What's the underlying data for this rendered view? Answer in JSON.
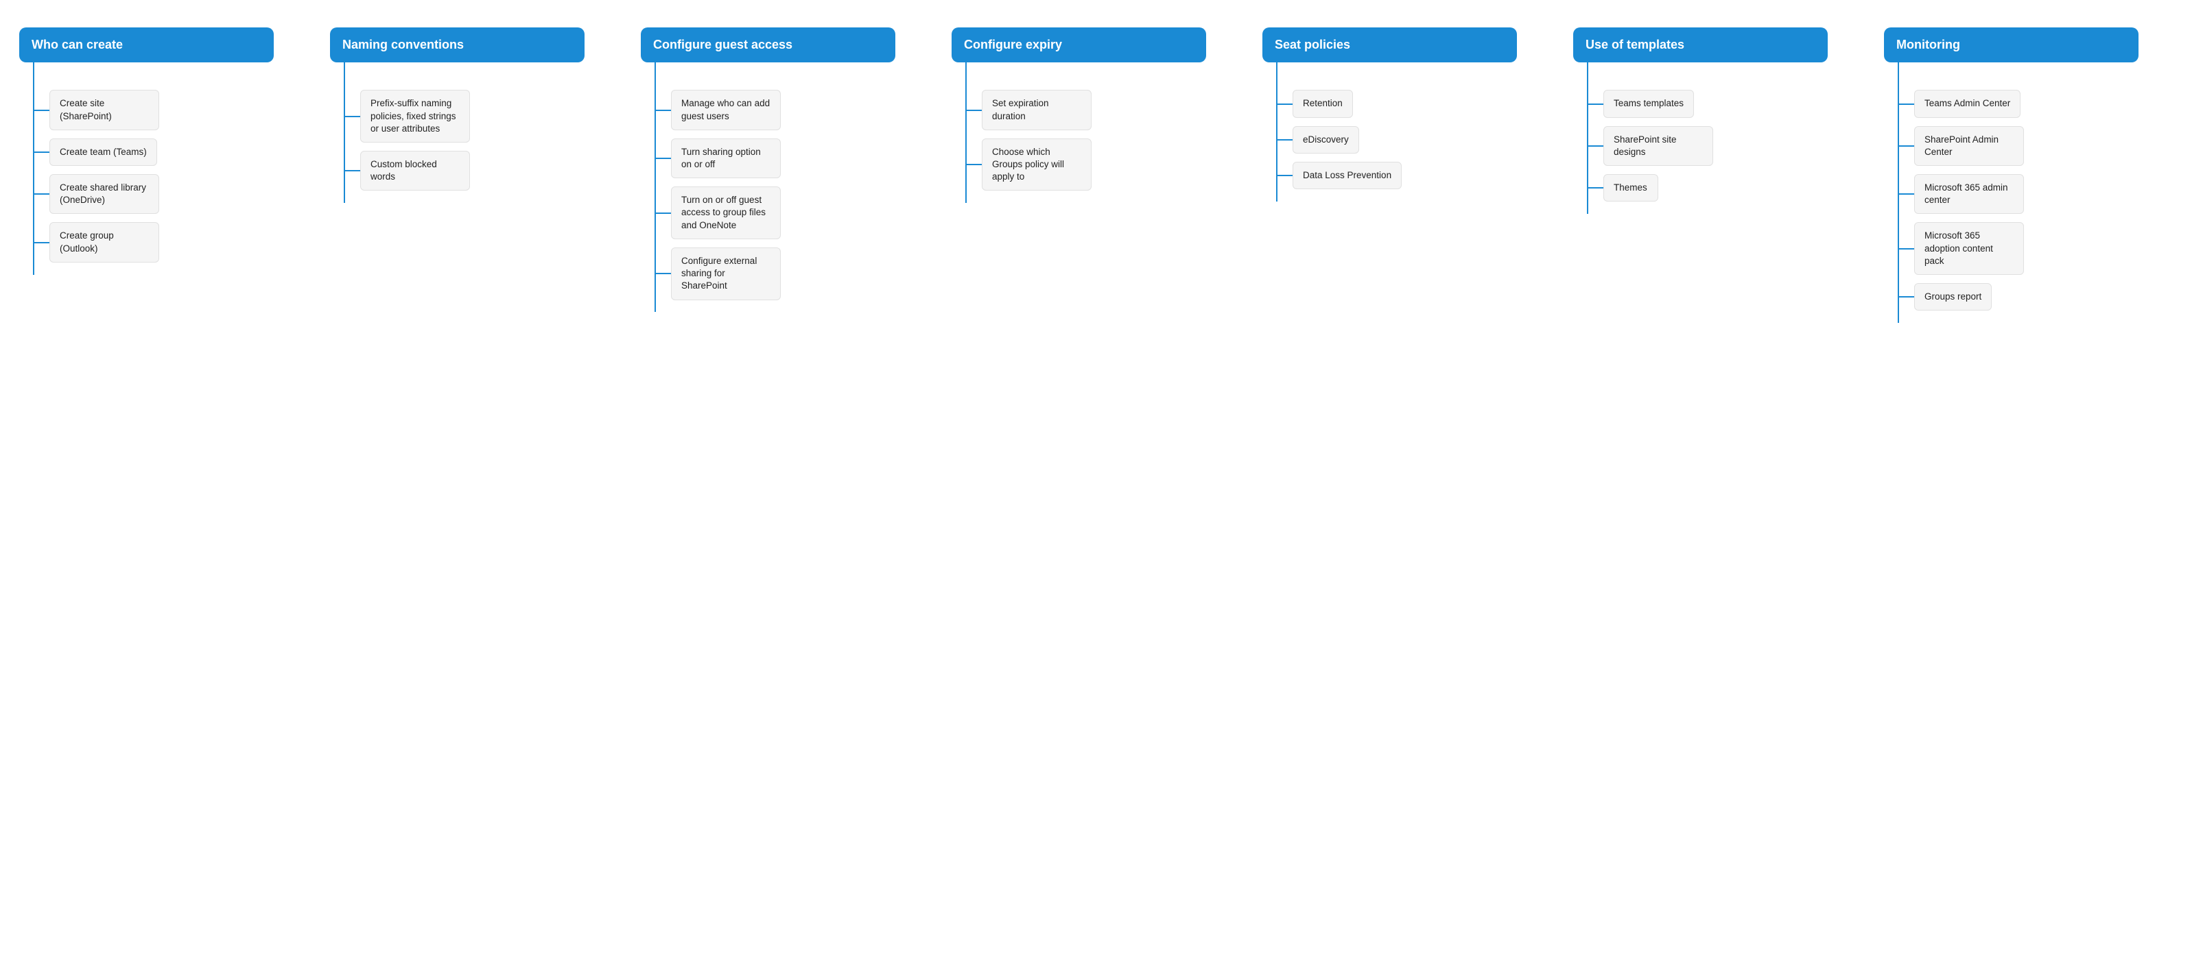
{
  "columns": [
    {
      "id": "who-can-create",
      "header": "Who can create",
      "items": [
        "Create site (SharePoint)",
        "Create team (Teams)",
        "Create shared library (OneDrive)",
        "Create group (Outlook)"
      ]
    },
    {
      "id": "naming-conventions",
      "header": "Naming conventions",
      "items": [
        "Prefix-suffix naming policies, fixed strings or user attributes",
        "Custom blocked words"
      ]
    },
    {
      "id": "configure-guest-access",
      "header": "Configure guest access",
      "items": [
        "Manage who can add guest users",
        "Turn sharing option on or off",
        "Turn on or off guest access to group files and OneNote",
        "Configure external sharing for SharePoint"
      ]
    },
    {
      "id": "configure-expiry",
      "header": "Configure expiry",
      "items": [
        "Set expiration duration",
        "Choose which Groups policy will apply to"
      ]
    },
    {
      "id": "seat-policies",
      "header": "Seat policies",
      "items": [
        "Retention",
        "eDiscovery",
        "Data Loss Prevention"
      ]
    },
    {
      "id": "use-of-templates",
      "header": "Use of templates",
      "items": [
        "Teams templates",
        "SharePoint site designs",
        "Themes"
      ]
    },
    {
      "id": "monitoring",
      "header": "Monitoring",
      "items": [
        "Teams Admin Center",
        "SharePoint Admin Center",
        "Microsoft 365 admin center",
        "Microsoft 365 adoption content pack",
        "Groups report"
      ]
    }
  ]
}
